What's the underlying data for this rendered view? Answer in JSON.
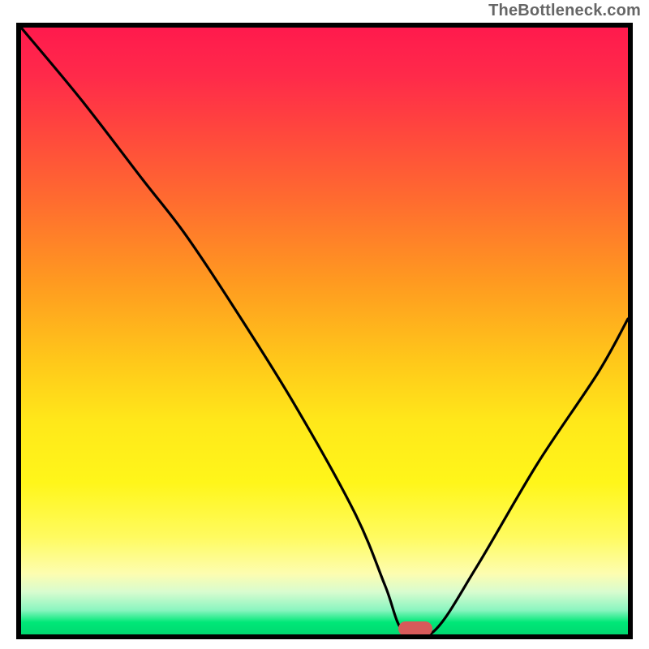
{
  "watermark": {
    "text": "TheBottleneck.com"
  },
  "frame": {
    "border_color": "#000000",
    "gradient_stops": [
      {
        "pos": 0,
        "color": "#ff1a4d"
      },
      {
        "pos": 100,
        "color": "#00d870"
      }
    ]
  },
  "marker": {
    "color": "#d85a5a",
    "x_pct": 65,
    "y_pct": 99
  },
  "chart_data": {
    "type": "line",
    "title": "",
    "xlabel": "",
    "ylabel": "",
    "xlim": [
      0,
      100
    ],
    "ylim": [
      0,
      100
    ],
    "grid": false,
    "legend": false,
    "series": [
      {
        "name": "bottleneck-curve",
        "x": [
          0,
          10,
          20,
          27,
          35,
          45,
          55,
          60,
          63,
          68,
          75,
          85,
          95,
          100
        ],
        "y": [
          100,
          88,
          75,
          66,
          54,
          38,
          20,
          8,
          0.5,
          0.5,
          11,
          28,
          43,
          52
        ]
      }
    ],
    "annotations": [
      {
        "type": "pill-marker",
        "x": 65,
        "y": 0.5,
        "color": "#d85a5a"
      }
    ]
  }
}
